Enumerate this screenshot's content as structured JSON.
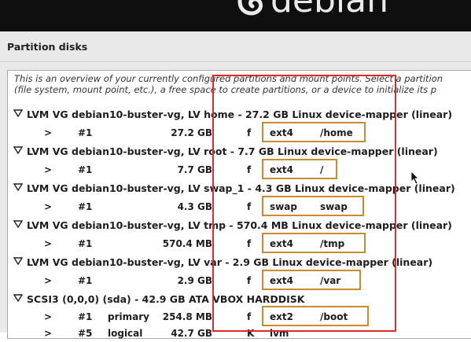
{
  "header": {
    "logo_text": "debian"
  },
  "title": "Partition disks",
  "intro": [
    "This is an overview of your currently configured partitions and mount points. Select a partition",
    "(file system, mount point, etc.), a free space to create partitions, or a device to initialize its p"
  ],
  "groups": [
    {
      "label": "LVM VG debian10-buster-vg, LV home - 27.2 GB Linux device-mapper (linear)",
      "partition": {
        "arrow": ">",
        "num": "#1",
        "type": "",
        "size": "27.2 GB",
        "flag": "f",
        "fs": "ext4",
        "mount": "/home"
      }
    },
    {
      "label": "LVM VG debian10-buster-vg, LV root - 7.7 GB Linux device-mapper (linear)",
      "partition": {
        "arrow": ">",
        "num": "#1",
        "type": "",
        "size": "7.7 GB",
        "flag": "f",
        "fs": "ext4",
        "mount": "/"
      }
    },
    {
      "label": "LVM VG debian10-buster-vg, LV swap_1 - 4.3 GB Linux device-mapper (linear)",
      "partition": {
        "arrow": ">",
        "num": "#1",
        "type": "",
        "size": "4.3 GB",
        "flag": "f",
        "fs": "swap",
        "mount": "swap"
      }
    },
    {
      "label": "LVM VG debian10-buster-vg, LV tmp - 570.4 MB Linux device-mapper (linear)",
      "partition": {
        "arrow": ">",
        "num": "#1",
        "type": "",
        "size": "570.4 MB",
        "flag": "f",
        "fs": "ext4",
        "mount": "/tmp"
      }
    },
    {
      "label": "LVM VG debian10-buster-vg, LV var - 2.9 GB Linux device-mapper (linear)",
      "partition": {
        "arrow": ">",
        "num": "#1",
        "type": "",
        "size": "2.9 GB",
        "flag": "f",
        "fs": "ext4",
        "mount": "/var"
      }
    },
    {
      "label": "SCSI3 (0,0,0) (sda) - 42.9 GB ATA VBOX HARDDISK",
      "partition": {
        "arrow": ">",
        "num": "#1",
        "type": "primary",
        "size": "254.8 MB",
        "flag": "f",
        "fs": "ext2",
        "mount": "/boot"
      }
    }
  ],
  "trailing_row": {
    "arrow": ">",
    "num": "#5",
    "type": "logical",
    "size": "42.7 GB",
    "flag": "K",
    "fs": "lvm"
  },
  "colors": {
    "header_bg": "#0f0f10",
    "highlight": "#c88b2d",
    "red_box": "#e0292c",
    "panel_bg": "#e9e9e9"
  }
}
